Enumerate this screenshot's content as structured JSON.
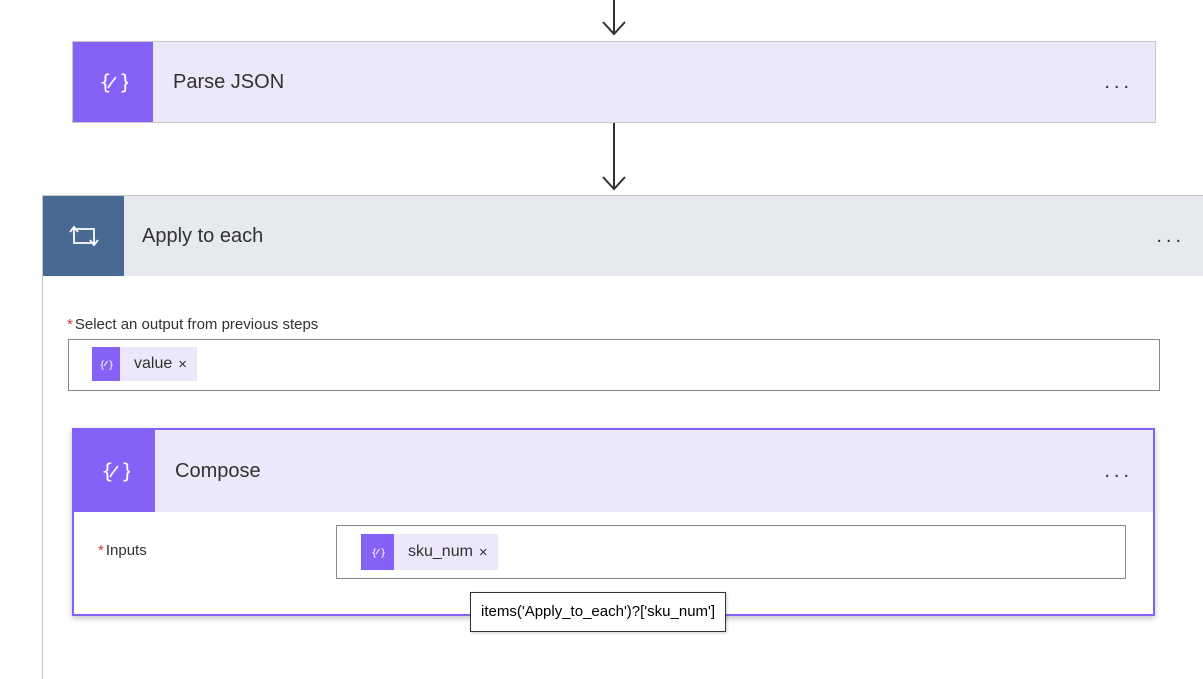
{
  "flow": {
    "parse_json": {
      "title": "Parse JSON",
      "more_label": "..."
    },
    "apply_to_each": {
      "title": "Apply to each",
      "more_label": "...",
      "select_output": {
        "required_mark": "*",
        "label": "Select an output from previous steps",
        "token": {
          "text": "value",
          "remove": "×"
        }
      }
    },
    "compose": {
      "title": "Compose",
      "more_label": "...",
      "inputs": {
        "required_mark": "*",
        "label": "Inputs",
        "token": {
          "text": "sku_num",
          "remove": "×"
        }
      }
    },
    "tooltip": "items('Apply_to_each')?['sku_num']"
  },
  "colors": {
    "data_operation": "#8661f5",
    "data_operation_light": "#ede7fb",
    "control": "#486991",
    "control_light": "#e6eaef",
    "required": "#d13438"
  },
  "icons": {
    "parse_json": "data-operation-icon",
    "apply_to_each": "loop-icon",
    "compose": "data-operation-icon",
    "arrow": "arrow-down-icon"
  }
}
